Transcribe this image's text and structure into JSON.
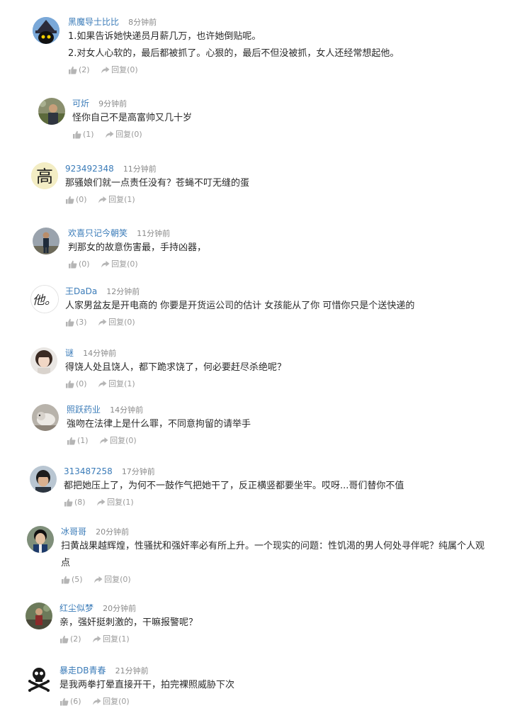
{
  "comments": [
    {
      "user": "黑魔导士比比",
      "time": "8分钟前",
      "avatar": "wizard-avatar",
      "lines": [
        "1.如果告诉她快递员月薪几万，也许她倒贴呢。",
        "2.对女人心软的，最后都被抓了。心狠的，最后不但没被抓，女人还经常想起他。"
      ],
      "likes": "(2)",
      "reply": "回复(0)"
    },
    {
      "user": "可炘",
      "time": "9分钟前",
      "avatar": "photo-avatar",
      "lines": [
        "怪你自己不是高富帅又几十岁"
      ],
      "likes": "(1)",
      "reply": "回复(0)"
    },
    {
      "user": "923492348",
      "time": "11分钟前",
      "avatar": "calligraphy-avatar",
      "lines": [
        "那骚娘们就一点责任没有？苍蝇不叮无缝的蛋"
      ],
      "likes": "(0)",
      "reply": "回复(1)"
    },
    {
      "user": "欢喜只记今朝笑",
      "time": "11分钟前",
      "avatar": "photo-avatar",
      "lines": [
        "判那女的故意伤害最，手持凶器，"
      ],
      "likes": "(0)",
      "reply": "回复(0)"
    },
    {
      "user": "王DaDa",
      "time": "12分钟前",
      "avatar": "handwriting-avatar",
      "lines": [
        "人家男盆友是开电商的 你要是开货运公司的估计 女孩能从了你 可惜你只是个送快递的"
      ],
      "likes": "(3)",
      "reply": "回复(0)"
    },
    {
      "user": "谜",
      "time": "14分钟前",
      "avatar": "photo-avatar",
      "lines": [
        "得饶人处且饶人，都下跪求饶了，何必要赶尽杀绝呢？"
      ],
      "likes": "(0)",
      "reply": "回复(1)"
    },
    {
      "user": "照跃药业",
      "time": "14分钟前",
      "avatar": "photo-avatar",
      "lines": [
        "強吻在法律上是什么罪，不同意拘留的请举手"
      ],
      "likes": "(1)",
      "reply": "回复(0)"
    },
    {
      "user": "313487258",
      "time": "17分钟前",
      "avatar": "photo-avatar",
      "lines": [
        "都把她压上了，为何不一鼓作气把她干了，反正横竖都要坐牢。哎呀...哥们替你不值"
      ],
      "likes": "(8)",
      "reply": "回复(1)"
    },
    {
      "user": "冰哥哥",
      "time": "20分钟前",
      "avatar": "photo-avatar",
      "lines": [
        "扫黄战果越辉煌，性骚扰和强奸率必有所上升。一个现实的问题：性饥渴的男人何处寻伴呢？纯属个人观点"
      ],
      "likes": "(5)",
      "reply": "回复(0)"
    },
    {
      "user": "红尘似梦",
      "time": "20分钟前",
      "avatar": "photo-avatar",
      "lines": [
        "亲，强奸挺刺激的，干嘛报警呢？"
      ],
      "likes": "(2)",
      "reply": "回复(1)"
    },
    {
      "user": "暴走DB青春",
      "time": "21分钟前",
      "avatar": "skull-avatar",
      "lines": [
        "是我两拳打晕直接开干，拍完裸照威胁下次"
      ],
      "likes": "(6)",
      "reply": "回复(0)"
    }
  ],
  "avatar_text": {
    "calligraphy": "高",
    "handwriting": "他。"
  },
  "colors": {
    "username": "#3a7bb8",
    "time": "#8a8a8a",
    "text": "#2a2a2a",
    "action": "#9a9a9a"
  }
}
